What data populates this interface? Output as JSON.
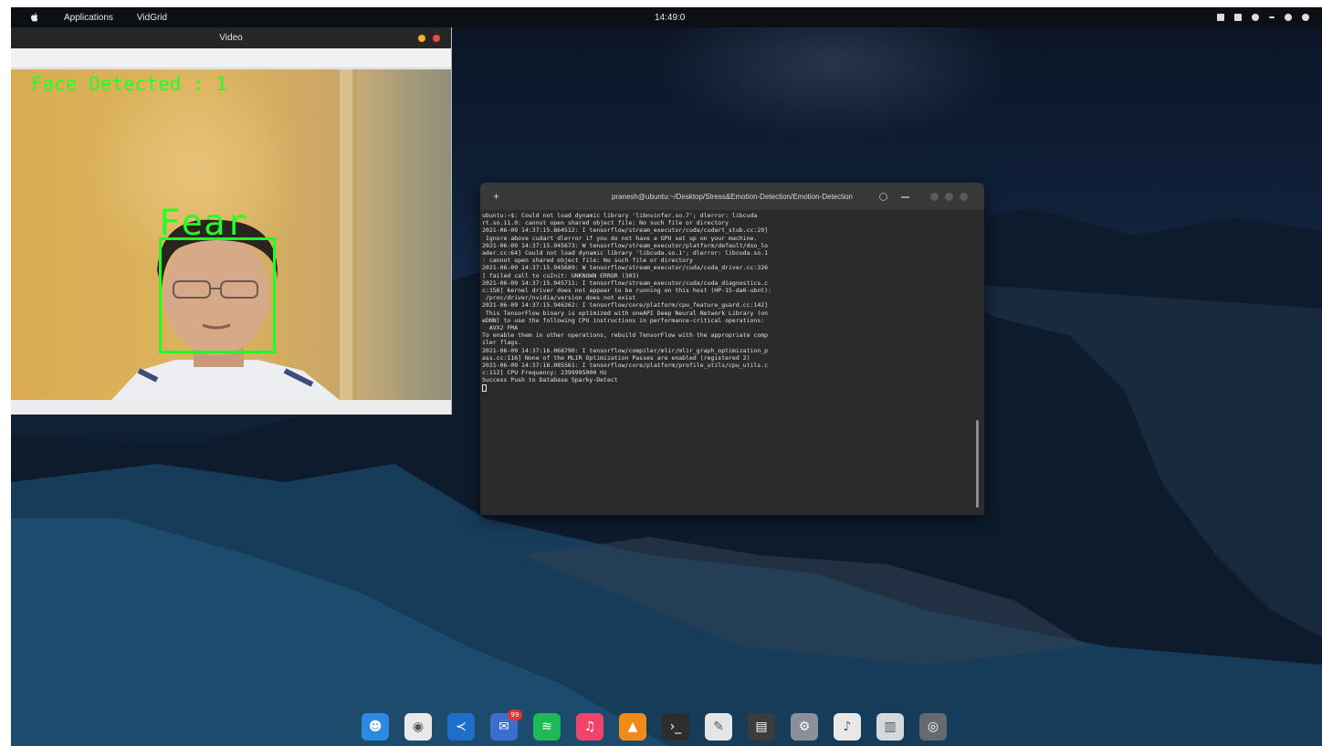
{
  "menubar": {
    "menus": [
      "Applications",
      "VidGrid"
    ],
    "clock": "14:49:0",
    "tray_icons": [
      "network-icon",
      "battery-icon",
      "wifi-icon",
      "volume-icon",
      "bluetooth-icon",
      "power-icon"
    ]
  },
  "video_window": {
    "title": "Video",
    "overlay": {
      "face_count_text": "Face Detected : 1",
      "emotion_label": "Fear",
      "box_color": "#1fff1f"
    }
  },
  "terminal": {
    "title": "pranesh@ubuntu:~/Desktop/Stress&Emotion-Detection/Emotion-Detection",
    "lines": [
      "ubuntu:~$: Could not load dynamic library 'libnvinfer.so.7'; dlerror: libcuda",
      "rt.so.11.0: cannot open shared object file: No such file or directory",
      "2021-06-09 14:37:15.864512: I tensorflow/stream_executor/cuda/cudart_stub.cc:29]",
      " Ignore above cudart dlerror if you do not have a GPU set up on your machine.",
      "2021-06-09 14:37:15.945673: W tensorflow/stream_executor/platform/default/dso_lo",
      "ader.cc:64] Could not load dynamic library 'libcuda.so.1'; dlerror: libcuda.so.1",
      ": cannot open shared object file: No such file or directory",
      "2021-06-09 14:37:15.945689: W tensorflow/stream_executor/cuda/cuda_driver.cc:326",
      "] failed call to cuInit: UNKNOWN ERROR (303)",
      "2021-06-09 14:37:15.945711: I tensorflow/stream_executor/cuda/cuda_diagnostics.c",
      "c:156] kernel driver does not appear to be running on this host (HP-15-da0-ubnt):",
      " /proc/driver/nvidia/version does not exist",
      "2021-06-09 14:37:15.946262: I tensorflow/core/platform/cpu_feature_guard.cc:142]",
      " This TensorFlow binary is optimized with oneAPI Deep Neural Network Library (on",
      "eDNN) to use the following CPU instructions in performance-critical operations:",
      "  AVX2 FMA",
      "To enable them in other operations, rebuild TensorFlow with the appropriate comp",
      "iler flags.",
      "2021-06-09 14:37:16.068790: I tensorflow/compiler/mlir/mlir_graph_optimization_p",
      "ass.cc:116] None of the MLIR Optimization Passes are enabled (registered 2)",
      "2021-06-09 14:37:16.085561: I tensorflow/core/platform/profile_utils/cpu_utils.c",
      "c:112] CPU Frequency: 2399995000 Hz",
      "Success Push to Database Sparky-Detect"
    ]
  },
  "dock": {
    "items": [
      {
        "name": "finder-icon",
        "glyph": "☻",
        "color": "#2a8be0"
      },
      {
        "name": "chrome-icon",
        "glyph": "◉",
        "color": "#e9e9e9"
      },
      {
        "name": "vscode-icon",
        "glyph": "≺",
        "color": "#1e6fc9"
      },
      {
        "name": "mail-icon",
        "glyph": "✉",
        "color": "#3a6fd0",
        "badge": "99"
      },
      {
        "name": "spotify-icon",
        "glyph": "≋",
        "color": "#1db954"
      },
      {
        "name": "music-icon",
        "glyph": "♫",
        "color": "#f2446a"
      },
      {
        "name": "vlc-icon",
        "glyph": "▲",
        "color": "#f28a1a"
      },
      {
        "name": "terminal-icon",
        "glyph": "›_",
        "color": "#2d2d2d"
      },
      {
        "name": "text-editor-icon",
        "glyph": "✎",
        "color": "#e5e5e5"
      },
      {
        "name": "system-monitor-icon",
        "glyph": "▤",
        "color": "#3c3c3c"
      },
      {
        "name": "settings-icon",
        "glyph": "⚙",
        "color": "#8a8f98"
      },
      {
        "name": "music-player-icon",
        "glyph": "♪",
        "color": "#e8e8e8"
      },
      {
        "name": "trash-icon",
        "glyph": "▥",
        "color": "#d5d8dc"
      },
      {
        "name": "launcher-icon",
        "glyph": "◎",
        "color": "#666a70"
      }
    ]
  }
}
